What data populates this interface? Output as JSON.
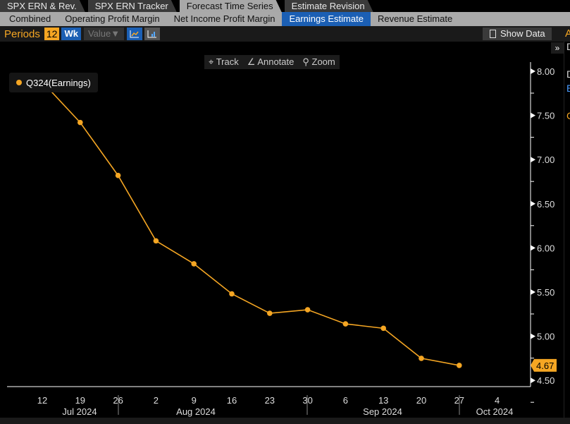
{
  "tabs": [
    "SPX ERN & Rev.",
    "SPX ERN Tracker",
    "Forecast Time Series",
    "Estimate Revision"
  ],
  "active_tab": 2,
  "subtabs": [
    "Combined",
    "Operating Profit Margin",
    "Net Income Profit Margin",
    "Earnings Estimate",
    "Revenue Estimate"
  ],
  "active_subtab": 3,
  "toolbar": {
    "periods_label": "Periods",
    "periods_value": "12",
    "unit": "Wk",
    "value_select": "Value▼",
    "show_data": "Show Data"
  },
  "chart_tools": {
    "track": "Track",
    "annotate": "Annotate",
    "zoom": "Zoom"
  },
  "side_panel": {
    "collapse": "»",
    "letters": [
      "A",
      "D",
      "D",
      "E",
      "C"
    ]
  },
  "chart_data": {
    "type": "line",
    "series": [
      {
        "name": "Q324(Earnings)",
        "color": "#f5a623",
        "x": [
          "2024-07-12",
          "2024-07-19",
          "2024-07-26",
          "2024-08-02",
          "2024-08-09",
          "2024-08-16",
          "2024-08-23",
          "2024-08-30",
          "2024-09-06",
          "2024-09-13",
          "2024-09-20",
          "2024-09-27"
        ],
        "values": [
          7.88,
          7.42,
          6.82,
          6.08,
          5.82,
          5.48,
          5.26,
          5.3,
          5.14,
          5.09,
          4.75,
          4.67
        ]
      }
    ],
    "last_value_label": "4.67",
    "x_ticks": [
      "12",
      "19",
      "26",
      "2",
      "9",
      "16",
      "23",
      "30",
      "6",
      "13",
      "20",
      "27",
      "4"
    ],
    "x_months": [
      "Jul 2024",
      "Aug 2024",
      "Sep 2024",
      "Oct 2024"
    ],
    "y_ticks": [
      "4.50",
      "5.00",
      "5.50",
      "6.00",
      "6.50",
      "7.00",
      "7.50",
      "8.00"
    ],
    "ylim": [
      4.4,
      8.15
    ],
    "legend": "top-left"
  }
}
